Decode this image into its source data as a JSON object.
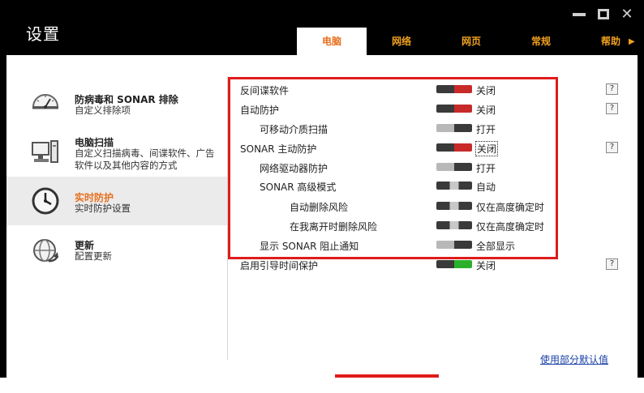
{
  "window": {
    "title": "设置",
    "controls": [
      "minimize",
      "maximize",
      "close"
    ]
  },
  "tabs": [
    {
      "label": "电脑",
      "active": true
    },
    {
      "label": "网络",
      "active": false
    },
    {
      "label": "网页",
      "active": false
    },
    {
      "label": "常规",
      "active": false
    },
    {
      "label": "帮助",
      "active": false
    }
  ],
  "sidebar": {
    "items": [
      {
        "title": "防病毒和 SONAR 排除",
        "subtitle": "自定义排除项",
        "icon": "gauge-icon"
      },
      {
        "title": "电脑扫描",
        "subtitle": "自定义扫描病毒、间谍软件、广告软件以及其他内容的方式",
        "icon": "computer-icon"
      },
      {
        "title": "实时防护",
        "subtitle": "实时防护设置",
        "icon": "clock-icon",
        "active": true
      },
      {
        "title": "更新",
        "subtitle": "配置更新",
        "icon": "globe-update-icon"
      }
    ]
  },
  "settings": {
    "rows": [
      {
        "label": "反间谍软件",
        "value": "关闭",
        "state": "off",
        "help": "?"
      },
      {
        "label": "自动防护",
        "value": "关闭",
        "state": "off",
        "help": "?"
      },
      {
        "label": "可移动介质扫描",
        "value": "打开",
        "state": "on"
      },
      {
        "label": "SONAR 主动防护",
        "value": "关闭",
        "state": "off",
        "help": "?"
      },
      {
        "label": "网络驱动器防护",
        "value": "打开",
        "state": "on"
      },
      {
        "label": "SONAR 高级模式",
        "value": "自动",
        "state": "mid"
      },
      {
        "label": "自动删除风险",
        "value": "仅在高度确定时",
        "state": "mid"
      },
      {
        "label": "在我离开时删除风险",
        "value": "仅在高度确定时",
        "state": "mid"
      },
      {
        "label": "显示 SONAR 阻止通知",
        "value": "全部显示",
        "state": "on"
      },
      {
        "label": "启用引导时间保护",
        "value": "关闭",
        "state": "green",
        "help": "?"
      }
    ]
  },
  "footer": {
    "reset_link": "使用部分默认值"
  },
  "colors": {
    "accent": "#e87020",
    "highlight": "#e01b1b",
    "link": "#1a3fa8"
  }
}
